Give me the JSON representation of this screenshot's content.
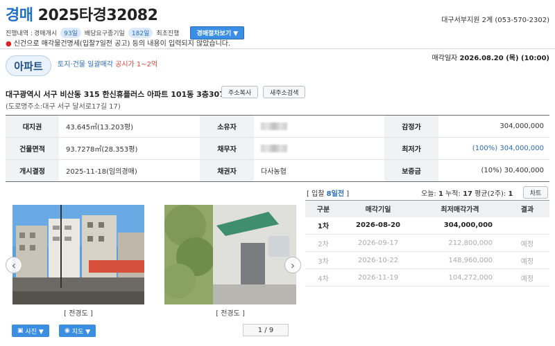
{
  "header": {
    "case_kind": "경매",
    "case_number": "2025타경32082",
    "court": "대구서부지원 2계 (053-570-2302)"
  },
  "progress": {
    "label": "진행내역 :",
    "opening": "경매개시",
    "opening_days": "93일",
    "deadline": "배당요구종기일",
    "deadline_days": "182일",
    "status": "최초진행",
    "procedure_button": "경매절차보기 ▼"
  },
  "notice": "신건으로 매각물건명세(입찰7일전 공고) 등의 내용이 입력되지 않았습니다.",
  "property": {
    "type": "아파트",
    "sale_type": "토지·건물 일괄매각",
    "price_range": "공시가 1~2억",
    "auction_date_label": "매각일자",
    "auction_date": "2026.08.20 (목) (10:00)",
    "address": "대구광역시 서구 비산동 315 한신휴플러스 아파트 101동 3층307호",
    "copy_address_button": "주소복사",
    "new_address_button": "새주소검색",
    "road_address": "(도로명주소:대구 서구 달서로17길 17)"
  },
  "info_table": {
    "rows": [
      {
        "l1": "대지권",
        "v1": "43.645㎡(13.203평)",
        "l2": "소유자",
        "v2": "",
        "l3": "감정가",
        "v3": "304,000,000"
      },
      {
        "l1": "건물면적",
        "v1": "93.7278㎡(28.353평)",
        "l2": "채무자",
        "v2": "",
        "l3": "최저가",
        "v3": "(100%) 304,000,000"
      },
      {
        "l1": "개시결정",
        "v1": "2025-11-18(임의경매)",
        "l2": "채권자",
        "v2": "다사농협",
        "l3": "보증금",
        "v3": "(10%) 30,400,000"
      }
    ]
  },
  "photos": {
    "captions": [
      "[ 전경도 ]",
      "[ 전경도 ]"
    ],
    "photo_button": "사진 ▼",
    "map_button": "지도 ▼",
    "pager": "1 / 9"
  },
  "bidding": {
    "bid_prefix": "[ 입찰 ",
    "bid_days": "8일전",
    "bid_suffix": " ]",
    "today_label": "오늘: ",
    "today": "1",
    "total_label": " 누적: ",
    "total": "17",
    "avg_label": " 평균(2주): ",
    "avg": "1",
    "times_button": "차트",
    "headers": [
      "구분",
      "매각기일",
      "최저매각가격",
      "결과"
    ],
    "rounds": [
      {
        "round": "1차",
        "date": "2026-08-20",
        "price": "304,000,000",
        "result": ""
      },
      {
        "round": "2차",
        "date": "2026-09-17",
        "price": "212,800,000",
        "result": "예정"
      },
      {
        "round": "3차",
        "date": "2026-10-22",
        "price": "148,960,000",
        "result": "예정"
      },
      {
        "round": "4차",
        "date": "2026-11-19",
        "price": "104,272,000",
        "result": "예정"
      }
    ]
  },
  "colors": {
    "accent": "#1f6fc5",
    "button_blue": "#3c8fe0",
    "highlight_red": "#e0443a"
  }
}
